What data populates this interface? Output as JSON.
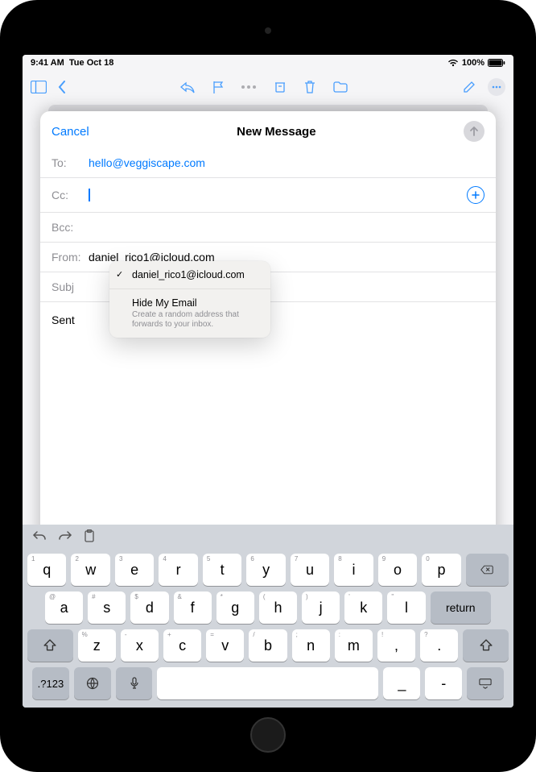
{
  "status": {
    "time": "9:41 AM",
    "date": "Tue Oct 18",
    "battery": "100%"
  },
  "sheet": {
    "cancel": "Cancel",
    "title": "New Message",
    "to_label": "To:",
    "to_value": "hello@veggiscape.com",
    "cc_label": "Cc:",
    "bcc_label": "Bcc:",
    "from_label": "From:",
    "from_value": "daniel_rico1@icloud.com",
    "subject_label": "Subj",
    "body_prefix": "Sent"
  },
  "from_popover": {
    "selected": "daniel_rico1@icloud.com",
    "hide_title": "Hide My Email",
    "hide_sub": "Create a random address that forwards to your inbox."
  },
  "keyboard": {
    "row1": [
      {
        "k": "q",
        "h": "1"
      },
      {
        "k": "w",
        "h": "2"
      },
      {
        "k": "e",
        "h": "3"
      },
      {
        "k": "r",
        "h": "4"
      },
      {
        "k": "t",
        "h": "5"
      },
      {
        "k": "y",
        "h": "6"
      },
      {
        "k": "u",
        "h": "7"
      },
      {
        "k": "i",
        "h": "8"
      },
      {
        "k": "o",
        "h": "9"
      },
      {
        "k": "p",
        "h": "0"
      }
    ],
    "row2": [
      {
        "k": "a",
        "h": "@"
      },
      {
        "k": "s",
        "h": "#"
      },
      {
        "k": "d",
        "h": "$"
      },
      {
        "k": "f",
        "h": "&"
      },
      {
        "k": "g",
        "h": "*"
      },
      {
        "k": "h",
        "h": "("
      },
      {
        "k": "j",
        "h": ")"
      },
      {
        "k": "k",
        "h": "'"
      },
      {
        "k": "l",
        "h": "\""
      }
    ],
    "row3": [
      {
        "k": "z",
        "h": "%"
      },
      {
        "k": "x",
        "h": "-"
      },
      {
        "k": "c",
        "h": "+"
      },
      {
        "k": "v",
        "h": "="
      },
      {
        "k": "b",
        "h": "/"
      },
      {
        "k": "n",
        "h": ";"
      },
      {
        "k": "m",
        "h": ":"
      }
    ],
    "numkey": ".?123",
    "return": "return",
    "underscore": "_",
    "dash": "-"
  }
}
